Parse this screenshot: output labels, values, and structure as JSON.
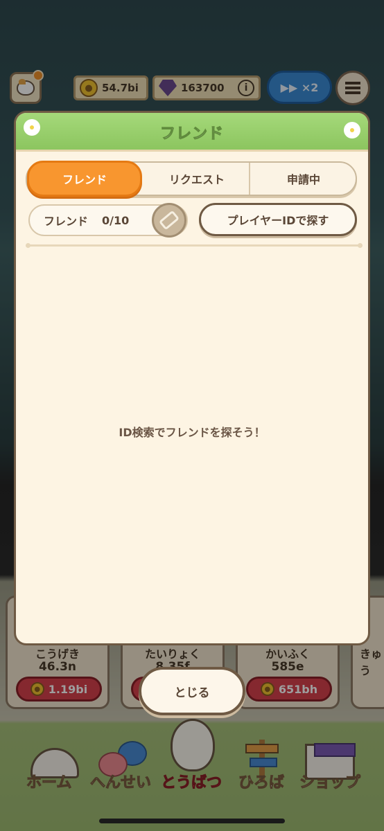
{
  "topbar": {
    "coins": "54.7bi",
    "gems": "163700",
    "info_symbol": "i",
    "speed_label": "▶▶ ×2"
  },
  "bg_cards": [
    {
      "title": "こうげき",
      "value": "46.3n",
      "price": "1.19bi"
    },
    {
      "title": "たいりょく",
      "value": "8.35f",
      "price": ""
    },
    {
      "title": "かいふく",
      "value": "585e",
      "price": "651bh"
    },
    {
      "title": "きゅう",
      "value": "",
      "price": ""
    }
  ],
  "bottom_nav": [
    {
      "label": "ホーム",
      "icon": "house-icon"
    },
    {
      "label": "へんせい",
      "icon": "cats-icon"
    },
    {
      "label": "とうばつ",
      "icon": "character-icon",
      "active": true
    },
    {
      "label": "ひろば",
      "icon": "signpost-icon"
    },
    {
      "label": "ショップ",
      "icon": "shop-icon"
    }
  ],
  "popup": {
    "title": "フレンド",
    "tabs": [
      "フレンド",
      "リクエスト",
      "申請中"
    ],
    "active_tab": 0,
    "friend_label": "フレンド",
    "friend_count": "0/10",
    "search_button": "プレイヤーIDで探す",
    "empty_message": "ID検索でフレンドを探そう！",
    "close_button": "とじる"
  },
  "colors": {
    "header_green": "#8cc55f",
    "active_tab_orange": "#f8962f",
    "popup_bg": "#fdf4e3",
    "border_brown": "#6f5a44",
    "active_nav_red": "#e2464c"
  }
}
